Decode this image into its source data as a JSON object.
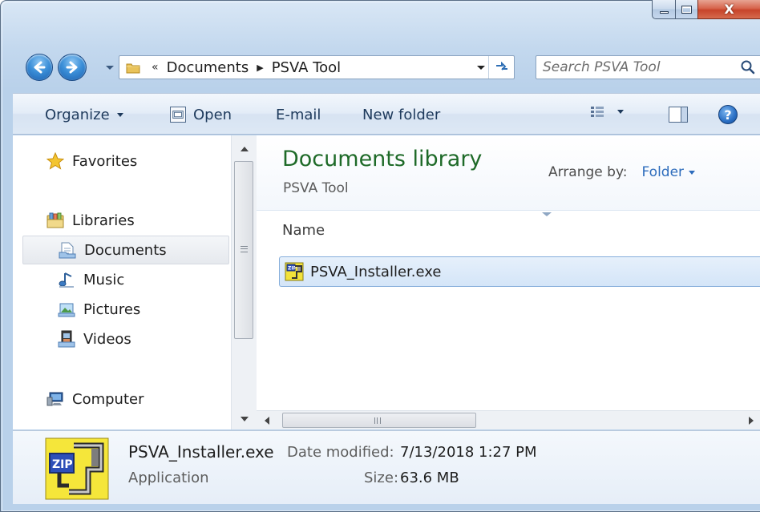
{
  "window": {
    "close_glyph": "X"
  },
  "nav": {
    "back_icon": "back-arrow-icon",
    "forward_icon": "forward-arrow-icon"
  },
  "address": {
    "overflow": "«",
    "segments": [
      "Documents",
      "PSVA Tool"
    ],
    "separator": "▶"
  },
  "search": {
    "placeholder": "Search PSVA Tool"
  },
  "toolbar": {
    "organize": "Organize",
    "open": "Open",
    "email": "E-mail",
    "new_folder": "New folder",
    "help": "?"
  },
  "sidebar": {
    "items": [
      {
        "label": "Favorites",
        "icon": "star-icon"
      },
      {
        "label": "Libraries",
        "icon": "libraries-icon"
      },
      {
        "label": "Documents",
        "icon": "documents-icon"
      },
      {
        "label": "Music",
        "icon": "music-icon"
      },
      {
        "label": "Pictures",
        "icon": "pictures-icon"
      },
      {
        "label": "Videos",
        "icon": "videos-icon"
      },
      {
        "label": "Computer",
        "icon": "computer-icon"
      }
    ]
  },
  "library": {
    "title": "Documents library",
    "subtitle": "PSVA Tool",
    "arrange_label": "Arrange by:",
    "arrange_value": "Folder"
  },
  "columns": {
    "name": "Name"
  },
  "files": [
    {
      "name": "PSVA_Installer.exe"
    }
  ],
  "details": {
    "name": "PSVA_Installer.exe",
    "type": "Application",
    "date_label": "Date modified:",
    "date_value": "7/13/2018 1:27 PM",
    "size_label": "Size:",
    "size_value": "63.6 MB"
  },
  "colors": {
    "library_title": "#1e6a28",
    "link": "#2d6cbc",
    "selection": "#d4e5f8"
  }
}
